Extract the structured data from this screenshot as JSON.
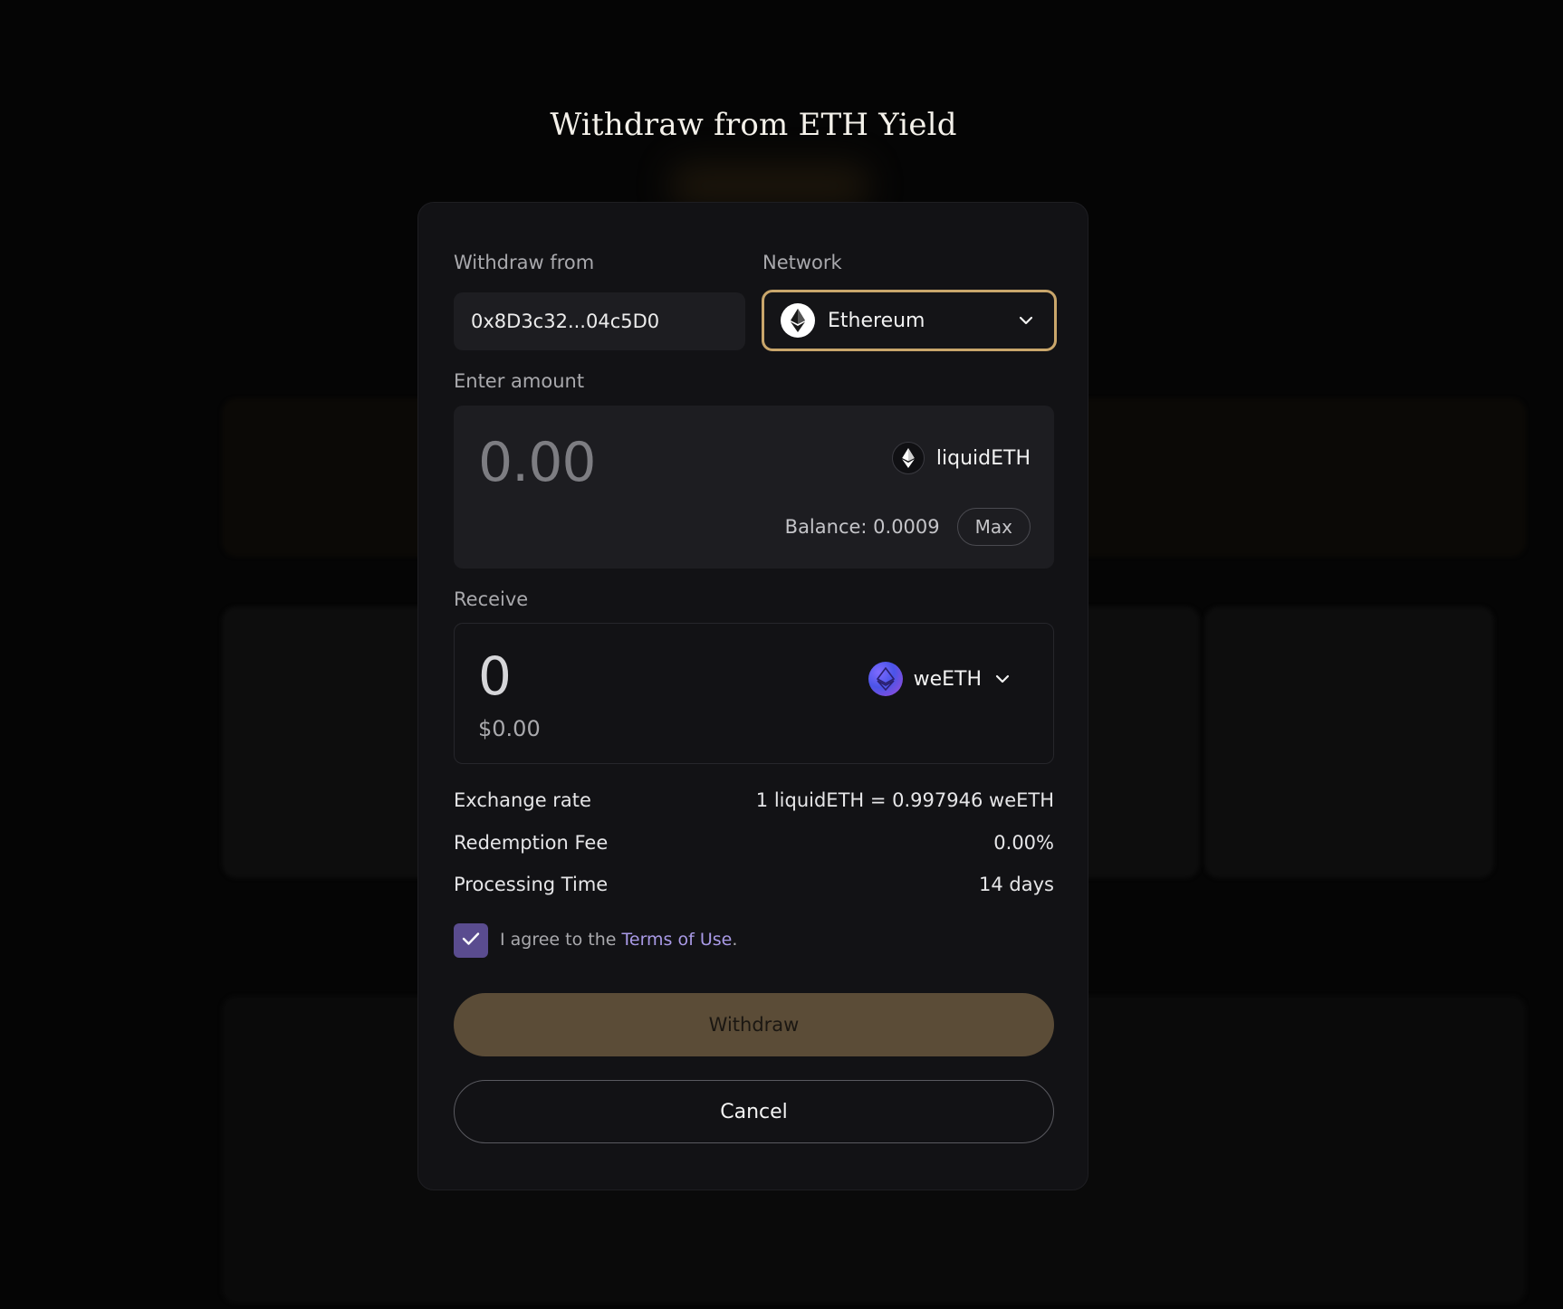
{
  "modal": {
    "title": "Withdraw from ETH Yield",
    "withdraw_from_label": "Withdraw from",
    "withdraw_from_value": "0x8D3c32...04c5D0",
    "network_label": "Network",
    "network_value": "Ethereum",
    "enter_amount_label": "Enter amount",
    "amount_value": "0.00",
    "amount_token": "liquidETH",
    "balance_text": "Balance: 0.0009",
    "max_label": "Max",
    "receive_label": "Receive",
    "receive_value": "0",
    "receive_usd": "$0.00",
    "receive_token": "weETH",
    "exchange_rate_label": "Exchange rate",
    "exchange_rate_value": "1 liquidETH = 0.997946 weETH",
    "redemption_fee_label": "Redemption Fee",
    "redemption_fee_value": "0.00%",
    "processing_time_label": "Processing Time",
    "processing_time_value": "14 days",
    "agree_prefix": "I agree to the ",
    "terms_link": "Terms of Use",
    "agree_suffix": ".",
    "agree_checked": true,
    "withdraw_label": "Withdraw",
    "cancel_label": "Cancel"
  },
  "icons": {
    "network": "ethereum-icon",
    "amount_token": "ethereum-icon",
    "receive_token": "weeth-icon",
    "dropdown": "chevron-down-icon",
    "checkbox": "check-icon"
  },
  "colors": {
    "accent_border": "#c9a66b",
    "withdraw_button": "#5b4c37",
    "checkbox": "#5a4c8f",
    "link": "#a99ae6"
  }
}
